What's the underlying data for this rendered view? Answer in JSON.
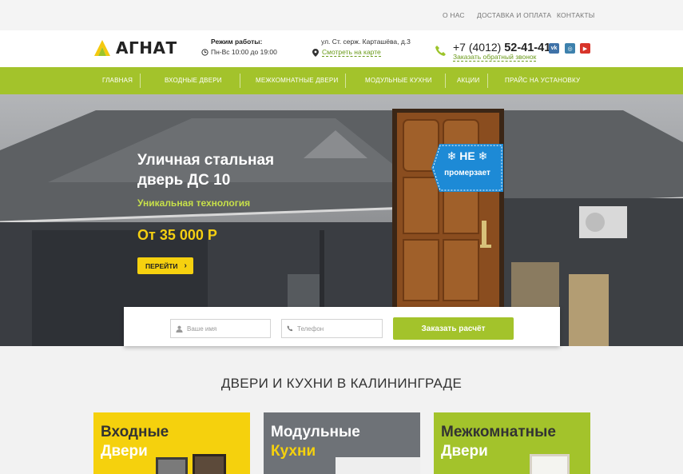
{
  "topbar": {
    "links": [
      "О НАС",
      "ДОСТАВКА И ОПЛАТА",
      "КОНТАКТЫ"
    ]
  },
  "header": {
    "logo_text": "АГНАТ",
    "hours_title": "Режим работы:",
    "hours_value": "Пн-Вс 10:00 до 19:00",
    "address": "ул. Ст. серж. Карташёва, д.3",
    "map_link": "Смотреть на карте",
    "phone_prefix": "+7 (4012)",
    "phone_number": "52-41-41",
    "callback_link": "Заказать обратный звонок",
    "social": [
      {
        "icon": "vk-icon",
        "label": "vk",
        "color": "#3f72a8"
      },
      {
        "icon": "instagram-icon",
        "label": "◎",
        "color": "#3d81ad"
      },
      {
        "icon": "youtube-icon",
        "label": "▶",
        "color": "#d8342a"
      }
    ]
  },
  "nav": {
    "items": [
      "ГЛАВНАЯ",
      "ВХОДНЫЕ ДВЕРИ",
      "МЕЖКОМНАТНЫЕ ДВЕРИ",
      "МОДУЛЬНЫЕ КУХНИ",
      "АКЦИИ",
      "ПРАЙС НА УСТАНОВКУ"
    ]
  },
  "hero": {
    "title": "Уличная стальная дверь ДС 10",
    "subtitle": "Уникальная технология",
    "price": "От 35 000 Р",
    "button": "ПЕРЕЙТИ",
    "badge_line1": "НЕ",
    "badge_line2": "промерзает"
  },
  "form": {
    "name_placeholder": "Ваше имя",
    "phone_placeholder": "Телефон",
    "submit": "Заказать расчёт"
  },
  "section": {
    "title": "ДВЕРИ И КУХНИ В КАЛИНИНГРАДЕ"
  },
  "cards": [
    {
      "line1": "Входные",
      "line2": "Двери"
    },
    {
      "line1": "Модульные",
      "line2": "Кухни"
    },
    {
      "line1": "Межкомнатные",
      "line2": "Двери"
    }
  ],
  "colors": {
    "accent_green": "#a3c32b",
    "accent_yellow": "#f6d10f",
    "link_green": "#6a9a1a"
  }
}
